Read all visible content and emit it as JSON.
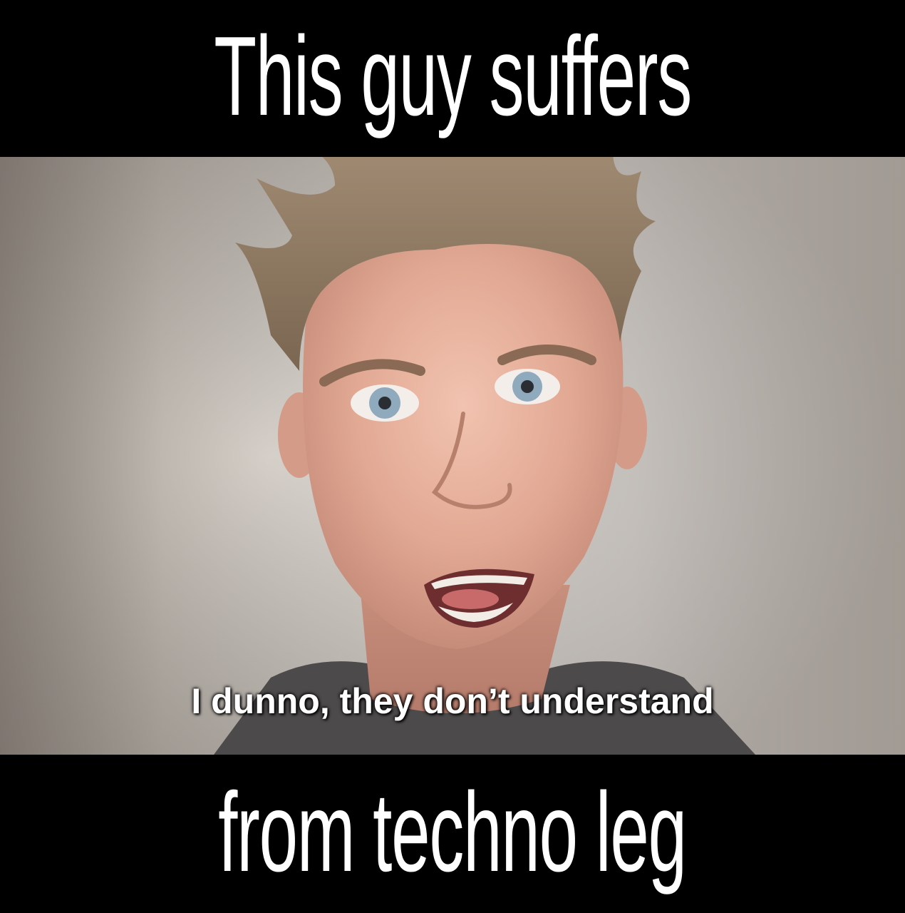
{
  "meme": {
    "top_caption": "This guy suffers",
    "bottom_caption": "from techno leg"
  },
  "video": {
    "subtitle": "I dunno, they don’t understand"
  }
}
